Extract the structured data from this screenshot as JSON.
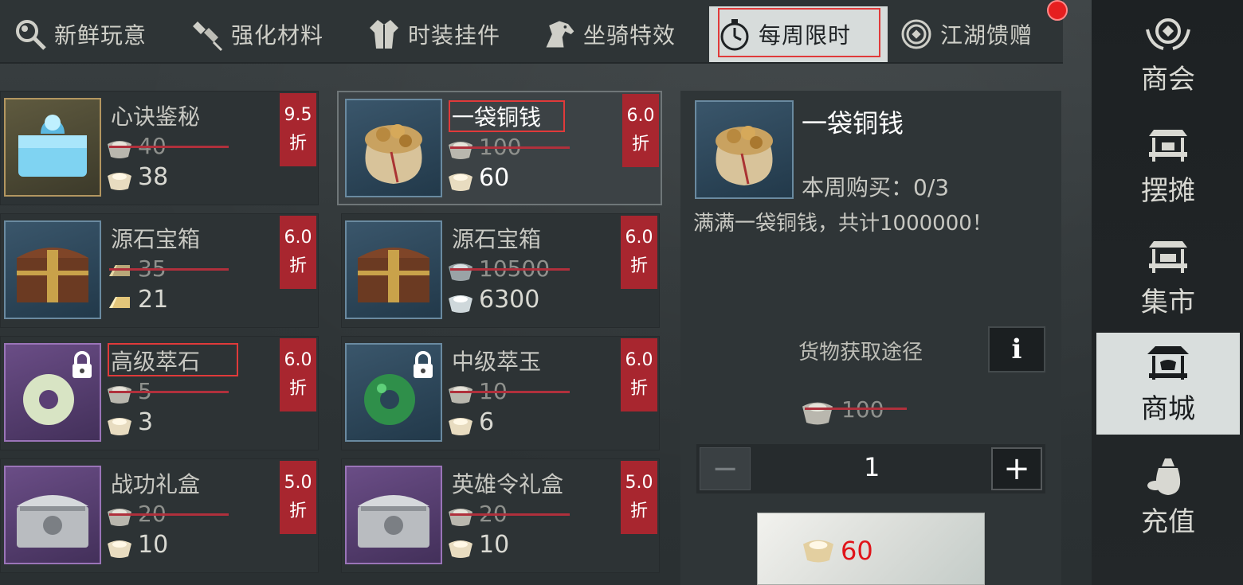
{
  "tabs": [
    {
      "label": "新鲜玩意",
      "icon": "magnifier-icon"
    },
    {
      "label": "强化材料",
      "icon": "material-icon"
    },
    {
      "label": "时装挂件",
      "icon": "robe-icon"
    },
    {
      "label": "坐骑特效",
      "icon": "horse-icon"
    },
    {
      "label": "每周限时",
      "icon": "stopwatch-icon",
      "active": true
    },
    {
      "label": "江湖馈赠",
      "icon": "gift-coin-icon"
    }
  ],
  "items": [
    {
      "name": "心诀鉴秘",
      "old_price": "40",
      "new_price": "38",
      "discount": "9.5",
      "discount_unit": "折",
      "currency": "ingot",
      "icon": "jade-box-icon"
    },
    {
      "name": "一袋铜钱",
      "old_price": "100",
      "new_price": "60",
      "discount": "6.0",
      "discount_unit": "折",
      "currency": "ingot",
      "icon": "coin-bag-icon",
      "selected": true
    },
    {
      "name": "源石宝箱",
      "old_price": "35",
      "new_price": "21",
      "discount": "6.0",
      "discount_unit": "折",
      "currency": "gold-bar",
      "icon": "treasure-chest-icon"
    },
    {
      "name": "源石宝箱",
      "old_price": "10500",
      "new_price": "6300",
      "discount": "6.0",
      "discount_unit": "折",
      "currency": "silver",
      "icon": "treasure-chest-icon"
    },
    {
      "name": "高级萃石",
      "old_price": "5",
      "new_price": "3",
      "discount": "6.0",
      "discount_unit": "折",
      "currency": "ingot",
      "icon": "white-jade-ring-icon",
      "locked": true
    },
    {
      "name": "中级萃玉",
      "old_price": "10",
      "new_price": "6",
      "discount": "6.0",
      "discount_unit": "折",
      "currency": "ingot",
      "icon": "green-jade-ring-icon",
      "locked": true
    },
    {
      "name": "战功礼盒",
      "old_price": "20",
      "new_price": "10",
      "discount": "5.0",
      "discount_unit": "折",
      "currency": "ingot",
      "icon": "silver-chest-icon"
    },
    {
      "name": "英雄令礼盒",
      "old_price": "20",
      "new_price": "10",
      "discount": "5.0",
      "discount_unit": "折",
      "currency": "ingot",
      "icon": "silver-chest-icon"
    }
  ],
  "detail": {
    "title": "一袋铜钱",
    "weekly_limit": "本周购买：0/3",
    "description": "满满一袋铜钱，共计1000000！",
    "source_label": "货物获取途径",
    "info_label": "i",
    "old_price": "100",
    "quantity": "1",
    "minus_label": "−",
    "plus_label": "+",
    "buy_price": "60"
  },
  "sidebar": [
    {
      "label": "商会",
      "icon": "guild-emblem-icon"
    },
    {
      "label": "摆摊",
      "icon": "stall-icon"
    },
    {
      "label": "集市",
      "icon": "market-icon"
    },
    {
      "label": "商城",
      "icon": "mall-icon",
      "active": true
    },
    {
      "label": "充值",
      "icon": "money-bag-icon"
    }
  ],
  "colors": {
    "discount_bg": "#a8262f",
    "highlight_box": "#e03a3a",
    "price_red": "#e0141a"
  }
}
